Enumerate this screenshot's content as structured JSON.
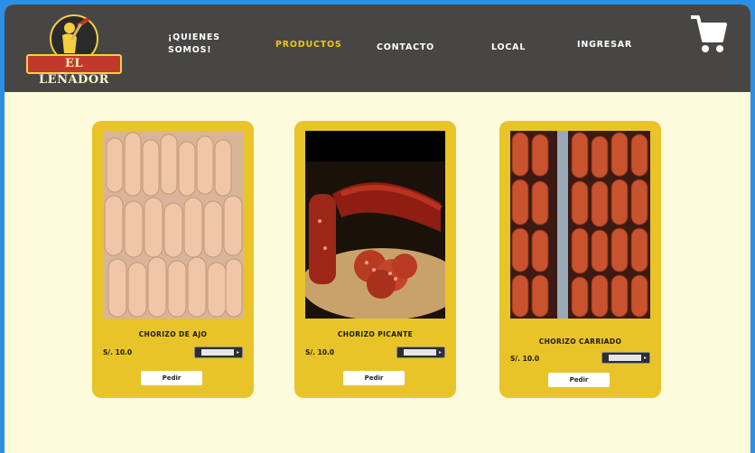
{
  "brand": {
    "logo_text": "EL LEÑADOR"
  },
  "nav": {
    "items": [
      {
        "label": "¡QUIENES SOMOS!",
        "active": false
      },
      {
        "label": "PRODUCTOS",
        "active": true
      },
      {
        "label": "CONTACTO",
        "active": false
      },
      {
        "label": "LOCAL",
        "active": false
      },
      {
        "label": "INGRESAR",
        "active": false
      }
    ],
    "cart_icon": "shopping-cart-icon"
  },
  "products": [
    {
      "name": "CHORIZO DE AJO",
      "price": "S/. 10.0",
      "button": "Pedir"
    },
    {
      "name": "CHORIZO PICANTE",
      "price": "S/. 10.0",
      "button": "Pedir"
    },
    {
      "name": "CHORIZO CARRIADO",
      "price": "S/. 10.0",
      "button": "Pedir"
    }
  ],
  "colors": {
    "navbar": "#474645",
    "background": "#fdfbdc",
    "card": "#e8c429",
    "active_nav": "#f0c419",
    "frame": "#2b8fe6"
  }
}
